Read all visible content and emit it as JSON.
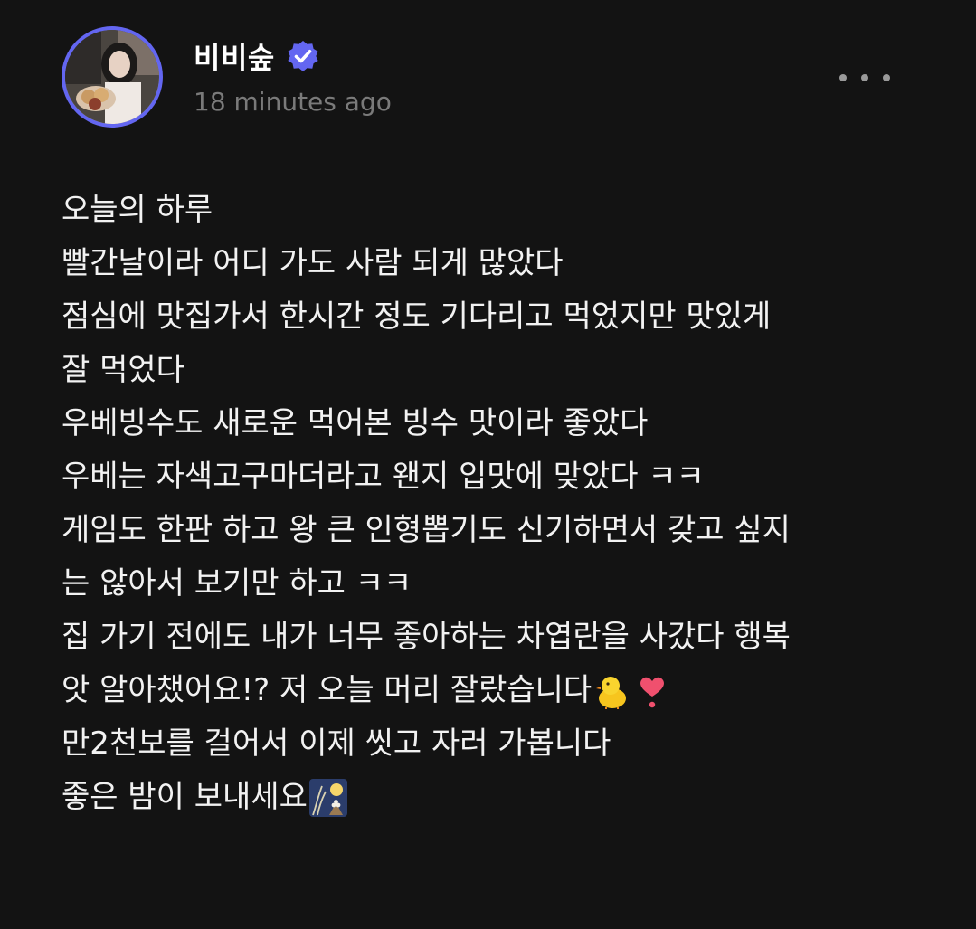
{
  "post": {
    "author": {
      "name": "비비숲",
      "verified": true,
      "avatar_icon": "avatar-photo-icon"
    },
    "timestamp": "18 minutes ago",
    "more_icon": "more-dots-icon",
    "lines": [
      {
        "text": "오늘의 하루",
        "emoji": []
      },
      {
        "text": "빨간날이라 어디 가도 사람 되게 많았다",
        "emoji": []
      },
      {
        "text": "점심에 맛집가서 한시간 정도 기다리고 먹었지만 맛있게",
        "emoji": []
      },
      {
        "text": "잘 먹었다",
        "emoji": []
      },
      {
        "text": "우베빙수도 새로운 먹어본 빙수 맛이라 좋았다",
        "emoji": []
      },
      {
        "text": "우베는 자색고구마더라고 왠지 입맛에 맞았다 ㅋㅋ",
        "emoji": []
      },
      {
        "text": "게임도 한판 하고 왕 큰 인형뽑기도 신기하면서 갖고 싶지",
        "emoji": []
      },
      {
        "text": "는 않아서 보기만 하고 ㅋㅋ",
        "emoji": []
      },
      {
        "text": "집 가기 전에도 내가 너무 좋아하는 차엽란을 사갔다 행복",
        "emoji": []
      },
      {
        "text": "앗 알아챘어요!? 저 오늘 머리 잘랐습니다",
        "emoji": [
          "chick-emoji",
          "heart-exclamation-emoji"
        ]
      },
      {
        "text": "만2천보를 걸어서 이제 씻고 자러 가봅니다",
        "emoji": []
      },
      {
        "text": "좋은 밤이 보내세요",
        "emoji": [
          "moon-viewing-emoji"
        ]
      }
    ]
  },
  "colors": {
    "background": "#131313",
    "text": "#f2f2f2",
    "muted": "#7a7a7a",
    "verified": "#6366f1"
  }
}
